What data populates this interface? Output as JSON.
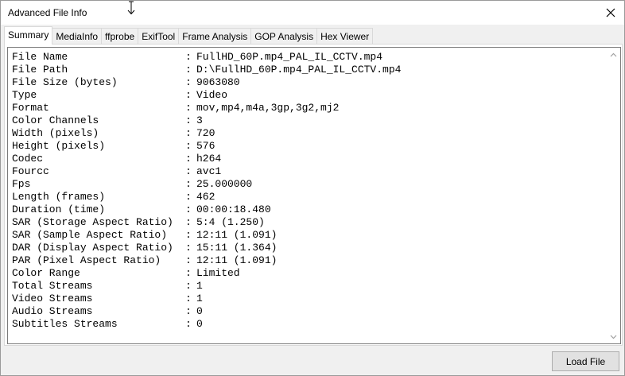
{
  "window": {
    "title": "Advanced File Info"
  },
  "tabs": [
    {
      "label": "Summary",
      "active": true
    },
    {
      "label": "MediaInfo",
      "active": false
    },
    {
      "label": "ffprobe",
      "active": false
    },
    {
      "label": "ExifTool",
      "active": false
    },
    {
      "label": "Frame Analysis",
      "active": false
    },
    {
      "label": "GOP Analysis",
      "active": false
    },
    {
      "label": "Hex Viewer",
      "active": false
    }
  ],
  "summary": {
    "separator": ":",
    "rows": [
      {
        "key": "File Name",
        "value": "FullHD_60P.mp4_PAL_IL_CCTV.mp4"
      },
      {
        "key": "File Path",
        "value": "D:\\FullHD_60P.mp4_PAL_IL_CCTV.mp4"
      },
      {
        "key": "File Size (bytes)",
        "value": "9063080"
      },
      {
        "key": "Type",
        "value": "Video"
      },
      {
        "key": "Format",
        "value": "mov,mp4,m4a,3gp,3g2,mj2"
      },
      {
        "key": "Color Channels",
        "value": "3"
      },
      {
        "key": "Width (pixels)",
        "value": "720"
      },
      {
        "key": "Height (pixels)",
        "value": "576"
      },
      {
        "key": "Codec",
        "value": "h264"
      },
      {
        "key": "Fourcc",
        "value": "avc1"
      },
      {
        "key": "Fps",
        "value": "25.000000"
      },
      {
        "key": "Length (frames)",
        "value": "462"
      },
      {
        "key": "Duration (time)",
        "value": "00:00:18.480"
      },
      {
        "key": "SAR (Storage Aspect Ratio)",
        "value": "5:4 (1.250)"
      },
      {
        "key": "SAR (Sample Aspect Ratio)",
        "value": "12:11 (1.091)"
      },
      {
        "key": "DAR (Display Aspect Ratio)",
        "value": "15:11 (1.364)"
      },
      {
        "key": "PAR (Pixel Aspect Ratio)",
        "value": "12:11 (1.091)"
      },
      {
        "key": "Color Range",
        "value": "Limited"
      },
      {
        "key": "Total Streams",
        "value": "1"
      },
      {
        "key": "Video Streams",
        "value": "1"
      },
      {
        "key": "Audio Streams",
        "value": "0"
      },
      {
        "key": "Subtitles Streams",
        "value": "0"
      }
    ]
  },
  "buttons": {
    "load_file": "Load File"
  },
  "icons": {
    "close": "close-icon",
    "cursor": "text-cursor-icon",
    "scroll_up": "chevron-up-icon",
    "scroll_down": "chevron-down-icon"
  }
}
